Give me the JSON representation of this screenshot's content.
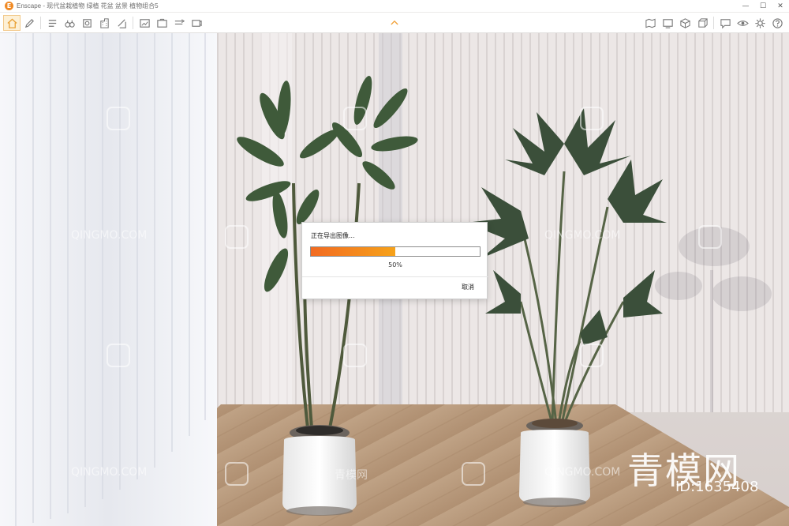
{
  "window": {
    "app_logo_letter": "E",
    "title": "Enscape - 现代盆栽植物 绿植 花盆 盆景 植物组合5",
    "minimize_glyph": "—",
    "maximize_glyph": "☐",
    "close_glyph": "✕"
  },
  "toolbar": {
    "left_icons": [
      "home-icon",
      "pen-icon",
      "list-icon",
      "binoculars-icon",
      "sun-icon",
      "building-icon",
      "clip-icon",
      "export-image-icon",
      "screenshot-icon",
      "video-icon",
      "panorama-icon"
    ],
    "right_icons": [
      "map-icon",
      "render-icon",
      "object-icon",
      "cube-icon",
      "chat-icon",
      "view-icon",
      "settings-icon",
      "help-icon"
    ],
    "accent_color": "#f2a23a"
  },
  "dialog": {
    "title": "正在导出图像...",
    "progress": 0.5,
    "progress_label": "50%",
    "cancel_label": "取消"
  },
  "watermarks": {
    "site_text": "QINGMO.COM",
    "cn_text": "青模网",
    "big_text": "青模网",
    "id_text": "ID:1635408"
  }
}
